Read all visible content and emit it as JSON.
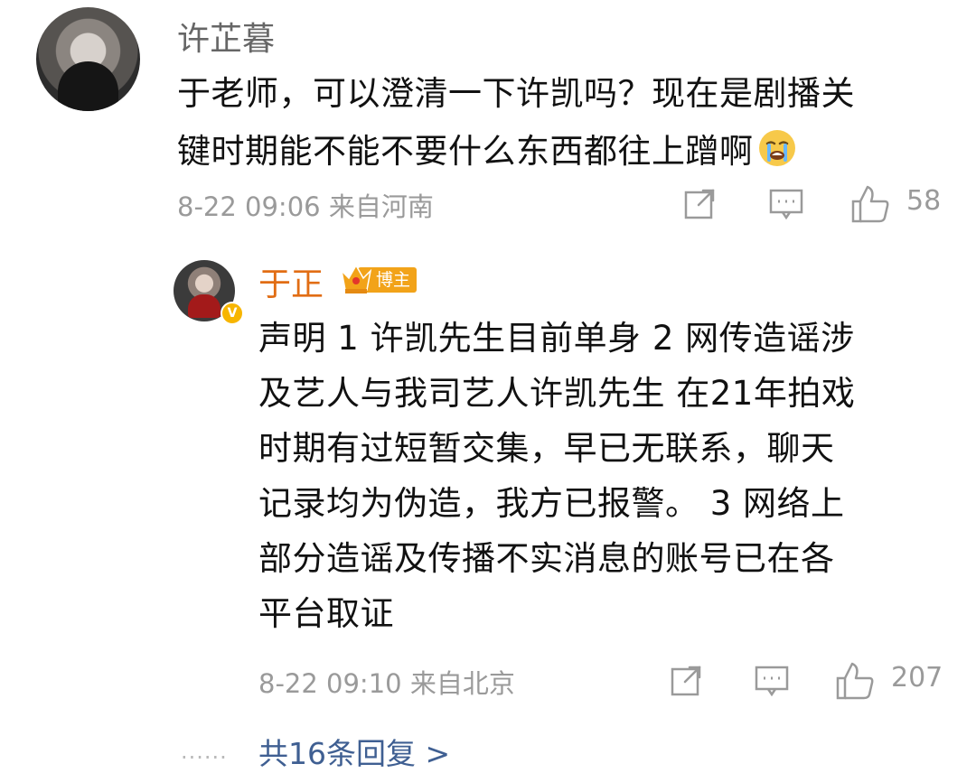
{
  "comment": {
    "username": "许芷暮",
    "text_lines": [
      "于老师，可以澄清一下许凯吗？现在是剧播关",
      "键时期能不能不要什么东西都往上蹭啊"
    ],
    "emoji": "crying-face-emoji",
    "meta": "8-22 09:06 来自河南",
    "likes": "58"
  },
  "reply": {
    "username": "于正",
    "badge_label": "博主",
    "verified_mark": "V",
    "text_lines": [
      "声明 1 许凯先生目前单身 2 网传造谣涉",
      "及艺人与我司艺人许凯先生 在21年拍戏",
      "时期有过短暂交集，早已无联系，聊天",
      "记录均为伪造，我方已报警。 3 网络上",
      "部分造谣及传播不实消息的账号已在各",
      "平台取证"
    ],
    "meta": "8-22 09:10 来自北京",
    "likes": "207"
  },
  "summary": {
    "dots": "......",
    "replies_label": "共16条回复 >"
  },
  "colors": {
    "username_gray": "#666666",
    "blogger_name_orange": "#e16d14",
    "badge_orange": "#f2a319",
    "meta_gray": "#9a9a9a",
    "link_blue": "#3f5f92"
  },
  "icons": {
    "share": "share-icon",
    "comment": "comment-icon",
    "like": "thumbs-up-icon",
    "crown": "crown-icon"
  }
}
